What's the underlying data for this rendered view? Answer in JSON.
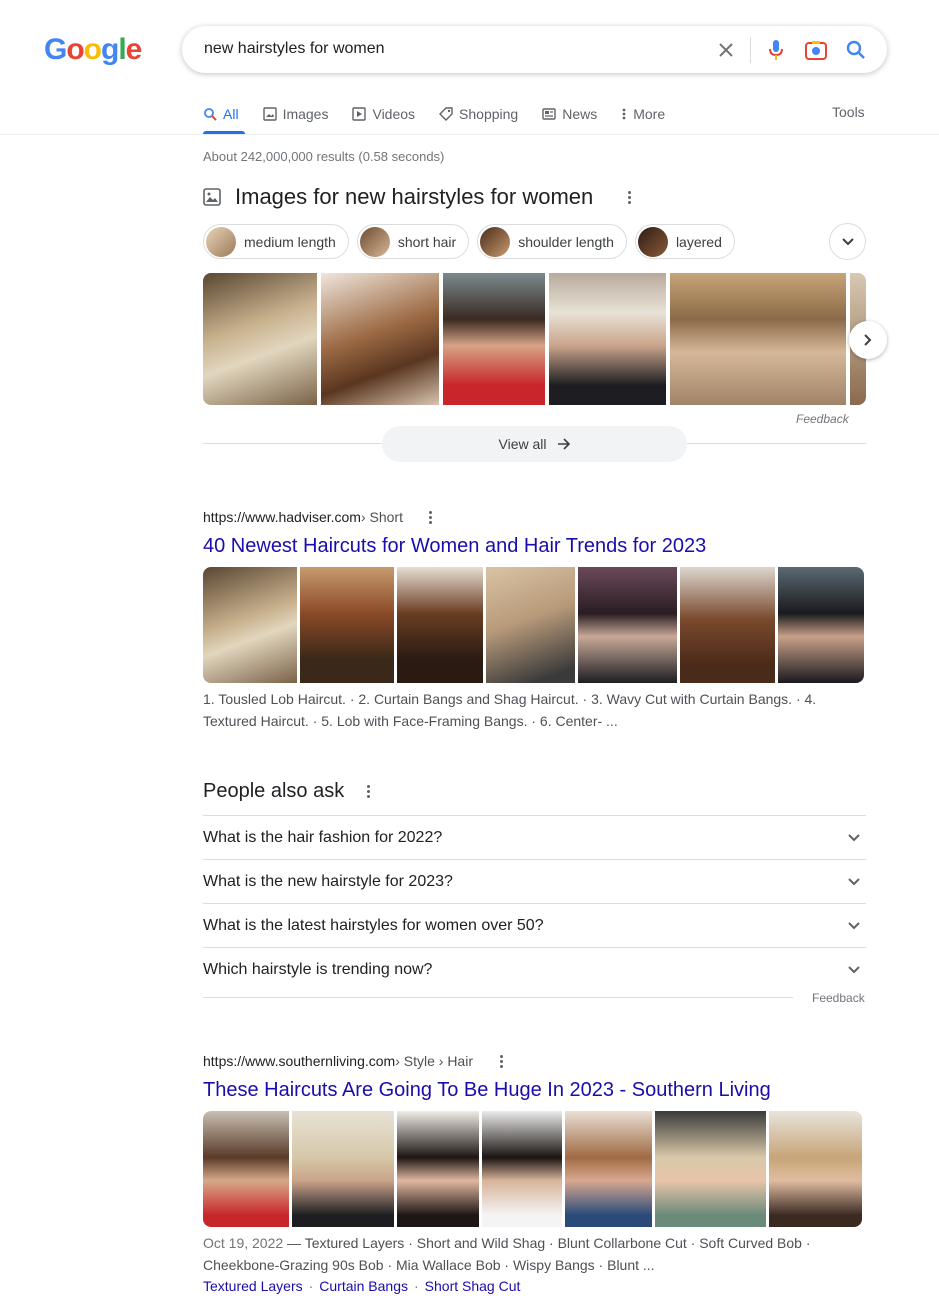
{
  "logo": {
    "g1": "G",
    "o1": "o",
    "o2": "o",
    "g2": "g",
    "l": "l",
    "e": "e"
  },
  "search": {
    "query": "new hairstyles for women"
  },
  "tabs": [
    {
      "label": "All",
      "icon": "search-icon"
    },
    {
      "label": "Images",
      "icon": "image-icon"
    },
    {
      "label": "Videos",
      "icon": "video-icon"
    },
    {
      "label": "Shopping",
      "icon": "tag-icon"
    },
    {
      "label": "News",
      "icon": "news-icon"
    },
    {
      "label": "More",
      "icon": "more-vert-icon"
    }
  ],
  "tools_label": "Tools",
  "result_stats": "About 242,000,000 results (0.58 seconds)",
  "images_block": {
    "title": "Images for new hairstyles for women",
    "chips": [
      "medium length",
      "short hair",
      "shoulder length",
      "layered"
    ],
    "feedback": "Feedback",
    "view_all": "View all"
  },
  "result1": {
    "url": "https://www.hadviser.com",
    "breadcrumb": " › Short",
    "title": "40 Newest Haircuts for Women and Hair Trends for 2023",
    "snippet": "1. Tousled Lob Haircut. · 2. Curtain Bangs and Shag Haircut. · 3. Wavy Cut with Curtain Bangs. · 4. Textured Haircut. · 5. Lob with Face-Framing Bangs. · 6. Center- ..."
  },
  "paa": {
    "title": "People also ask",
    "questions": [
      "What is the hair fashion for 2022?",
      "What is the new hairstyle for 2023?",
      "What is the latest hairstyles for women over 50?",
      "Which hairstyle is trending now?"
    ],
    "feedback": "Feedback"
  },
  "result2": {
    "url": "https://www.southernliving.com",
    "breadcrumb": " › Style › Hair",
    "title": "These Haircuts Are Going To Be Huge In 2023 - Southern Living",
    "date": "Oct 19, 2022",
    "snippet": " — Textured Layers · Short and Wild Shag · Blunt Collarbone Cut · Soft Curved Bob · Cheekbone-Grazing 90s Bob · Mia Wallace Bob · Wispy Bangs · Blunt ...",
    "links": [
      "Textured Layers",
      "Curtain Bangs",
      "Short Shag Cut"
    ]
  },
  "colors": {
    "link": "#1a0dab",
    "accent": "#1a73e8",
    "muted": "#70757a"
  }
}
